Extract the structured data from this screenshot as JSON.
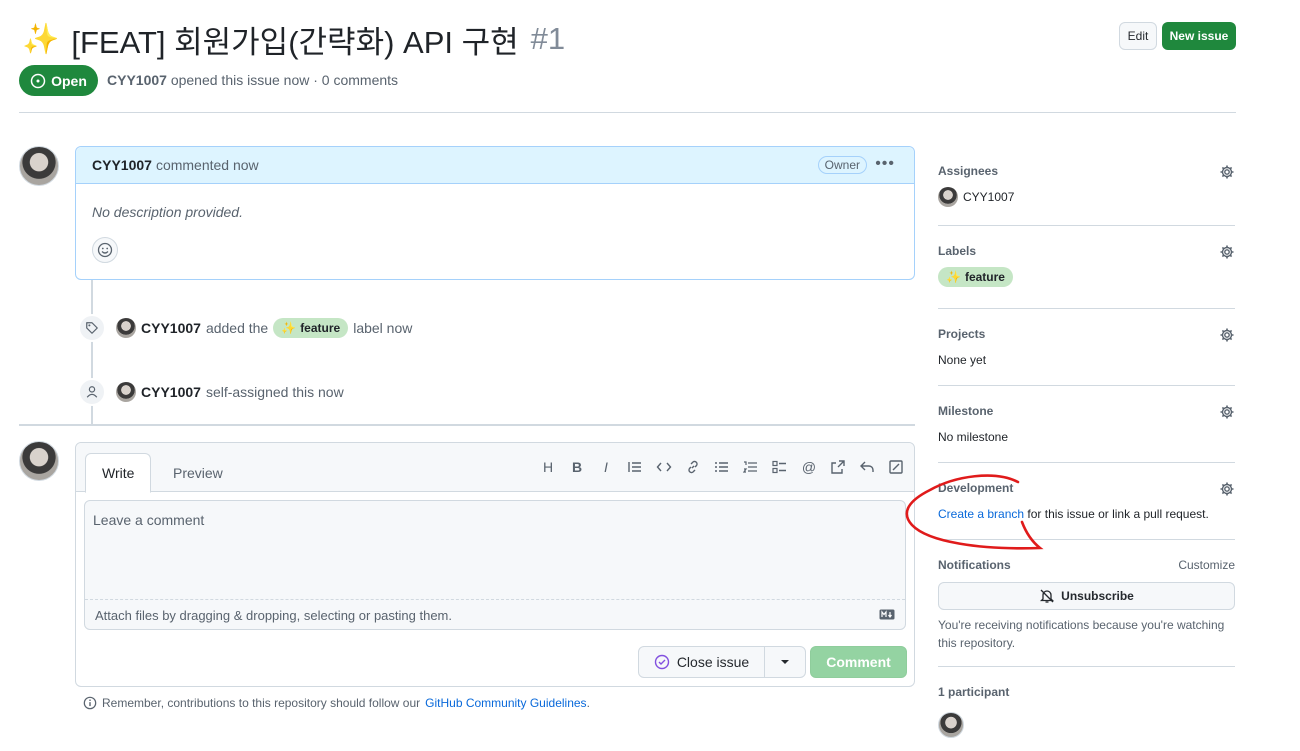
{
  "issue": {
    "sparkle": "✨",
    "title": "[FEAT] 회원가입(간략화) API 구현",
    "number": "#1",
    "state": "Open",
    "author": "CYY1007",
    "meta": "opened this issue now · 0 comments"
  },
  "header_actions": {
    "edit": "Edit",
    "new_issue": "New issue"
  },
  "comment": {
    "author": "CYY1007",
    "action": "commented now",
    "role_badge": "Owner",
    "more": "•••",
    "body": "No description provided."
  },
  "timeline": [
    {
      "author": "CYY1007",
      "pre": "added the",
      "label": "feature",
      "label_emoji": "✨",
      "post": "label now"
    },
    {
      "author": "CYY1007",
      "text": "self-assigned this now"
    }
  ],
  "editor": {
    "tab_write": "Write",
    "tab_preview": "Preview",
    "placeholder": "Leave a comment",
    "attach": "Attach files by dragging & dropping, selecting or pasting them.",
    "close_issue": "Close issue",
    "comment": "Comment",
    "toolbar": [
      "H",
      "B",
      "I",
      "⁝",
      "<>",
      "🔗",
      "≡",
      "1≡",
      "☑",
      "@",
      "↗",
      "↩",
      "⤢"
    ]
  },
  "guidelines": {
    "text": "Remember, contributions to this repository should follow our",
    "link": "GitHub Community Guidelines",
    "end": "."
  },
  "sidebar": {
    "assignees": {
      "title": "Assignees",
      "value": "CYY1007"
    },
    "labels": {
      "title": "Labels",
      "value": "feature",
      "emoji": "✨"
    },
    "projects": {
      "title": "Projects",
      "value": "None yet"
    },
    "milestone": {
      "title": "Milestone",
      "value": "No milestone"
    },
    "development": {
      "title": "Development",
      "link": "Create a branch",
      "rest": "for this issue or link a pull request."
    },
    "notifications": {
      "title": "Notifications",
      "customize": "Customize",
      "unsubscribe": "Unsubscribe",
      "note": "You're receiving notifications because you're watching this repository."
    },
    "participants": {
      "title": "1 participant"
    }
  },
  "colors": {
    "green": "#1f883d",
    "link": "#0969da",
    "annotation": "#e01b1b"
  }
}
